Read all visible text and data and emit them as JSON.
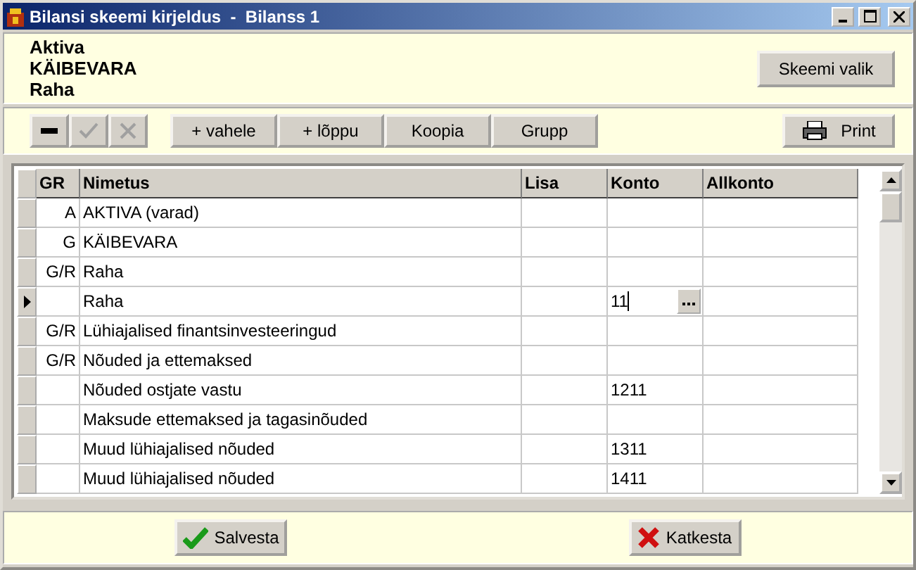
{
  "window": {
    "title": "Bilansi skeemi kirjeldus  -  Bilanss 1"
  },
  "breadcrumb": [
    "Aktiva",
    "KÄIBEVARA",
    "Raha"
  ],
  "scheme_button": {
    "label": "Skeemi valik"
  },
  "toolbar": {
    "icon_buttons": [
      {
        "kind": "minus",
        "disabled": false
      },
      {
        "kind": "check",
        "disabled": true
      },
      {
        "kind": "cross",
        "disabled": true
      }
    ],
    "buttons": [
      {
        "label": "+ vahele"
      },
      {
        "label": "+ lõppu"
      },
      {
        "label": "Koopia"
      },
      {
        "label": "Grupp"
      }
    ],
    "print": {
      "label": "Print"
    }
  },
  "table": {
    "columns": [
      "GR",
      "Nimetus",
      "Lisa",
      "Konto",
      "Allkonto"
    ],
    "rows": [
      {
        "gr": "A",
        "name": "AKTIVA  (varad)",
        "lisa": "",
        "konto": "",
        "allkonto": "",
        "current": false
      },
      {
        "gr": "G",
        "name": "KÄIBEVARA",
        "lisa": "",
        "konto": "",
        "allkonto": "",
        "current": false
      },
      {
        "gr": "G/R",
        "name": "Raha",
        "lisa": "",
        "konto": "",
        "allkonto": "",
        "current": false
      },
      {
        "gr": "",
        "name": "Raha",
        "lisa": "",
        "konto": "11",
        "allkonto": "",
        "current": true
      },
      {
        "gr": "G/R",
        "name": "Lühiajalised finantsinvesteeringud",
        "lisa": "",
        "konto": "",
        "allkonto": "",
        "current": false
      },
      {
        "gr": "G/R",
        "name": "Nõuded ja ettemaksed",
        "lisa": "",
        "konto": "",
        "allkonto": "",
        "current": false
      },
      {
        "gr": "",
        "name": "Nõuded ostjate vastu",
        "lisa": "",
        "konto": "1211",
        "allkonto": "",
        "current": false
      },
      {
        "gr": "",
        "name": "Maksude ettemaksed ja tagasinõuded",
        "lisa": "",
        "konto": "",
        "allkonto": "",
        "current": false
      },
      {
        "gr": "",
        "name": "Muud lühiajalised nõuded",
        "lisa": "",
        "konto": "1311",
        "allkonto": "",
        "current": false
      },
      {
        "gr": "",
        "name": "Muud lühiajalised nõuded",
        "lisa": "",
        "konto": "1411",
        "allkonto": "",
        "current": false
      }
    ]
  },
  "footer": {
    "buttons": [
      {
        "kind": "save",
        "label": "Salvesta"
      },
      {
        "kind": "cancel",
        "label": "Katkesta"
      }
    ]
  }
}
